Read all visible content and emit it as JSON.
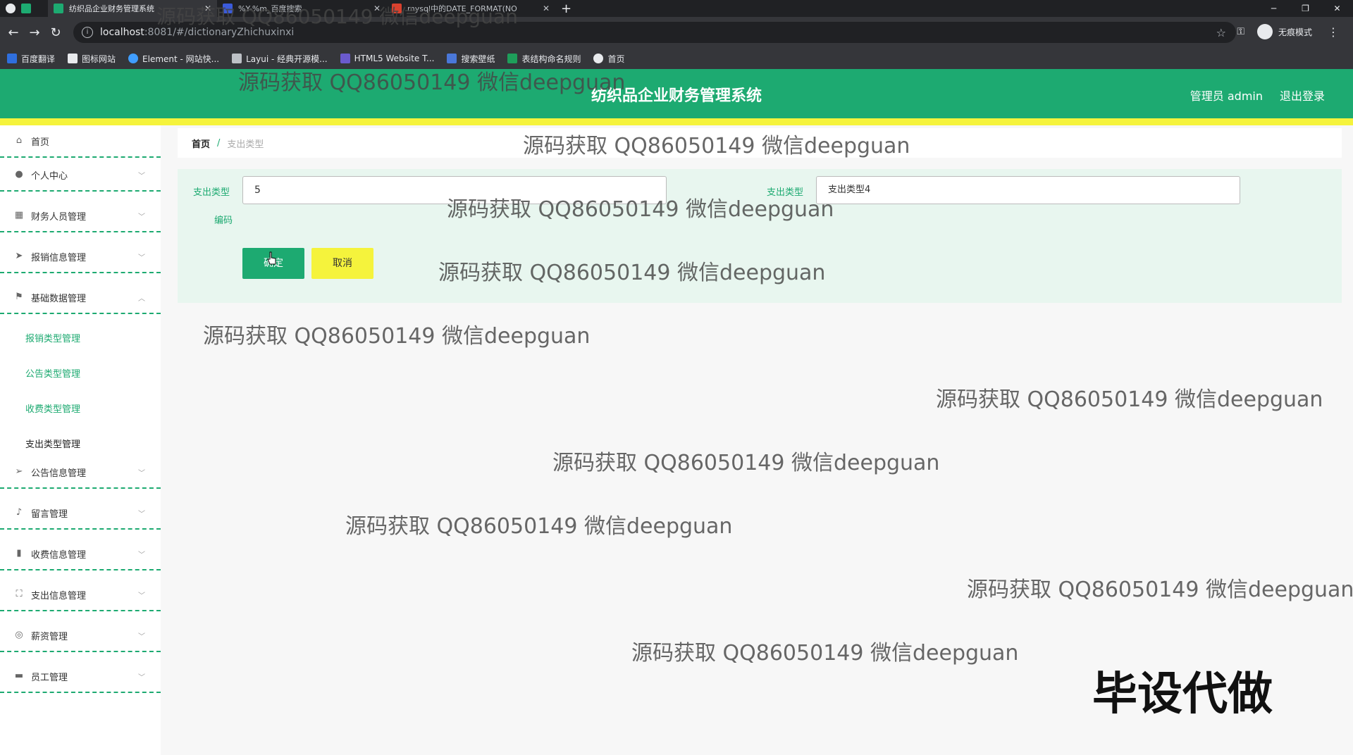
{
  "browser": {
    "tabs": [
      {
        "title": "纺织品企业财务管理系统",
        "fav": "#1daa71"
      },
      {
        "title": "%Y-%m_百度搜索",
        "fav": "#3b5bdb"
      },
      {
        "title": "mysql中的DATE_FORMAT(NO",
        "fav": "#d9412e"
      }
    ],
    "new_tab": "+",
    "url_host": "localhost",
    "url_rest": ":8081/#/dictionaryZhichuxinxi",
    "incognito_label": "无痕模式",
    "bookmarks": [
      "百度翻译",
      "图标网站",
      "Element - 网站快...",
      "Layui - 经典开源模...",
      "HTML5 Website T...",
      "搜索壁纸",
      "表结构命名规则",
      "首页"
    ]
  },
  "header": {
    "title": "纺织品企业财务管理系统",
    "user": "管理员 admin",
    "logout": "退出登录"
  },
  "sidebar": {
    "items": [
      {
        "label": "首页",
        "icon": "home-icon"
      },
      {
        "label": "个人中心",
        "icon": "user-icon"
      },
      {
        "label": "财务人员管理",
        "icon": "grid-icon"
      },
      {
        "label": "报销信息管理",
        "icon": "send-icon"
      },
      {
        "label": "基础数据管理",
        "icon": "flag-icon"
      },
      {
        "label": "公告信息管理",
        "icon": "paper-plane-icon"
      },
      {
        "label": "留言管理",
        "icon": "mic-icon"
      },
      {
        "label": "收费信息管理",
        "icon": "chart-icon"
      },
      {
        "label": "支出信息管理",
        "icon": "expand-icon"
      },
      {
        "label": "薪资管理",
        "icon": "circle-icon"
      },
      {
        "label": "员工管理",
        "icon": "monitor-icon"
      }
    ],
    "subitems": [
      "报销类型管理",
      "公告类型管理",
      "收费类型管理",
      "支出类型管理"
    ]
  },
  "breadcrumb": {
    "home": "首页",
    "sep": "/",
    "current": "支出类型"
  },
  "form": {
    "code_label_1": "支出类型",
    "code_label_2": "编码",
    "code_value": "5",
    "type_label": "支出类型",
    "type_value": "支出类型4",
    "save_label": "确定",
    "cancel_label": "取消"
  },
  "watermarks": {
    "text": "源码获取 QQ86050149 微信deepguan",
    "big": "毕设代做"
  }
}
